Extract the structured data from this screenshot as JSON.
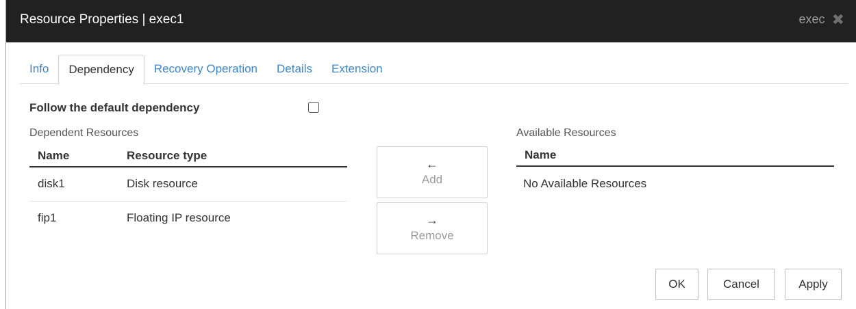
{
  "window": {
    "title": "Resource Properties | exec1",
    "type_label": "exec",
    "close_icon": "close-icon"
  },
  "tabs": [
    {
      "label": "Info",
      "active": false
    },
    {
      "label": "Dependency",
      "active": true
    },
    {
      "label": "Recovery Operation",
      "active": false
    },
    {
      "label": "Details",
      "active": false
    },
    {
      "label": "Extension",
      "active": false
    }
  ],
  "follow_default": {
    "label": "Follow the default dependency",
    "checked": false
  },
  "dependent": {
    "heading": "Dependent Resources",
    "columns": [
      "Name",
      "Resource type"
    ],
    "rows": [
      {
        "name": "disk1",
        "type": "Disk resource"
      },
      {
        "name": "fip1",
        "type": "Floating IP resource"
      }
    ]
  },
  "move_buttons": {
    "add": {
      "arrow": "←",
      "label": "Add"
    },
    "remove": {
      "arrow": "→",
      "label": "Remove"
    }
  },
  "available": {
    "heading": "Available Resources",
    "columns": [
      "Name"
    ],
    "empty_text": "No Available Resources"
  },
  "footer": {
    "ok_label": "OK",
    "cancel_label": "Cancel",
    "apply_label": "Apply"
  },
  "colors": {
    "titlebar": "#212121",
    "tab_link": "#3d86c6",
    "disabled_text": "#9a9a9a"
  }
}
